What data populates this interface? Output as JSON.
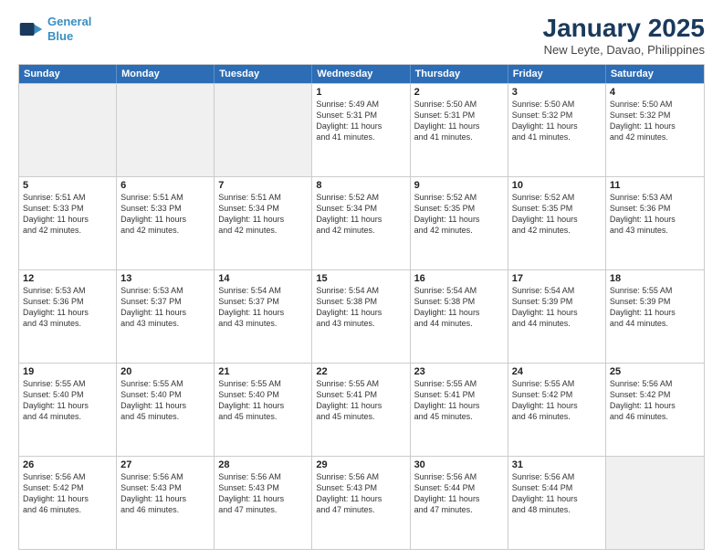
{
  "logo": {
    "line1": "General",
    "line2": "Blue"
  },
  "title": "January 2025",
  "subtitle": "New Leyte, Davao, Philippines",
  "weekdays": [
    "Sunday",
    "Monday",
    "Tuesday",
    "Wednesday",
    "Thursday",
    "Friday",
    "Saturday"
  ],
  "weeks": [
    [
      {
        "day": "",
        "info": "",
        "shaded": true
      },
      {
        "day": "",
        "info": "",
        "shaded": true
      },
      {
        "day": "",
        "info": "",
        "shaded": true
      },
      {
        "day": "1",
        "info": "Sunrise: 5:49 AM\nSunset: 5:31 PM\nDaylight: 11 hours\nand 41 minutes.",
        "shaded": false
      },
      {
        "day": "2",
        "info": "Sunrise: 5:50 AM\nSunset: 5:31 PM\nDaylight: 11 hours\nand 41 minutes.",
        "shaded": false
      },
      {
        "day": "3",
        "info": "Sunrise: 5:50 AM\nSunset: 5:32 PM\nDaylight: 11 hours\nand 41 minutes.",
        "shaded": false
      },
      {
        "day": "4",
        "info": "Sunrise: 5:50 AM\nSunset: 5:32 PM\nDaylight: 11 hours\nand 42 minutes.",
        "shaded": false
      }
    ],
    [
      {
        "day": "5",
        "info": "Sunrise: 5:51 AM\nSunset: 5:33 PM\nDaylight: 11 hours\nand 42 minutes.",
        "shaded": false
      },
      {
        "day": "6",
        "info": "Sunrise: 5:51 AM\nSunset: 5:33 PM\nDaylight: 11 hours\nand 42 minutes.",
        "shaded": false
      },
      {
        "day": "7",
        "info": "Sunrise: 5:51 AM\nSunset: 5:34 PM\nDaylight: 11 hours\nand 42 minutes.",
        "shaded": false
      },
      {
        "day": "8",
        "info": "Sunrise: 5:52 AM\nSunset: 5:34 PM\nDaylight: 11 hours\nand 42 minutes.",
        "shaded": false
      },
      {
        "day": "9",
        "info": "Sunrise: 5:52 AM\nSunset: 5:35 PM\nDaylight: 11 hours\nand 42 minutes.",
        "shaded": false
      },
      {
        "day": "10",
        "info": "Sunrise: 5:52 AM\nSunset: 5:35 PM\nDaylight: 11 hours\nand 42 minutes.",
        "shaded": false
      },
      {
        "day": "11",
        "info": "Sunrise: 5:53 AM\nSunset: 5:36 PM\nDaylight: 11 hours\nand 43 minutes.",
        "shaded": false
      }
    ],
    [
      {
        "day": "12",
        "info": "Sunrise: 5:53 AM\nSunset: 5:36 PM\nDaylight: 11 hours\nand 43 minutes.",
        "shaded": false
      },
      {
        "day": "13",
        "info": "Sunrise: 5:53 AM\nSunset: 5:37 PM\nDaylight: 11 hours\nand 43 minutes.",
        "shaded": false
      },
      {
        "day": "14",
        "info": "Sunrise: 5:54 AM\nSunset: 5:37 PM\nDaylight: 11 hours\nand 43 minutes.",
        "shaded": false
      },
      {
        "day": "15",
        "info": "Sunrise: 5:54 AM\nSunset: 5:38 PM\nDaylight: 11 hours\nand 43 minutes.",
        "shaded": false
      },
      {
        "day": "16",
        "info": "Sunrise: 5:54 AM\nSunset: 5:38 PM\nDaylight: 11 hours\nand 44 minutes.",
        "shaded": false
      },
      {
        "day": "17",
        "info": "Sunrise: 5:54 AM\nSunset: 5:39 PM\nDaylight: 11 hours\nand 44 minutes.",
        "shaded": false
      },
      {
        "day": "18",
        "info": "Sunrise: 5:55 AM\nSunset: 5:39 PM\nDaylight: 11 hours\nand 44 minutes.",
        "shaded": false
      }
    ],
    [
      {
        "day": "19",
        "info": "Sunrise: 5:55 AM\nSunset: 5:40 PM\nDaylight: 11 hours\nand 44 minutes.",
        "shaded": false
      },
      {
        "day": "20",
        "info": "Sunrise: 5:55 AM\nSunset: 5:40 PM\nDaylight: 11 hours\nand 45 minutes.",
        "shaded": false
      },
      {
        "day": "21",
        "info": "Sunrise: 5:55 AM\nSunset: 5:40 PM\nDaylight: 11 hours\nand 45 minutes.",
        "shaded": false
      },
      {
        "day": "22",
        "info": "Sunrise: 5:55 AM\nSunset: 5:41 PM\nDaylight: 11 hours\nand 45 minutes.",
        "shaded": false
      },
      {
        "day": "23",
        "info": "Sunrise: 5:55 AM\nSunset: 5:41 PM\nDaylight: 11 hours\nand 45 minutes.",
        "shaded": false
      },
      {
        "day": "24",
        "info": "Sunrise: 5:55 AM\nSunset: 5:42 PM\nDaylight: 11 hours\nand 46 minutes.",
        "shaded": false
      },
      {
        "day": "25",
        "info": "Sunrise: 5:56 AM\nSunset: 5:42 PM\nDaylight: 11 hours\nand 46 minutes.",
        "shaded": false
      }
    ],
    [
      {
        "day": "26",
        "info": "Sunrise: 5:56 AM\nSunset: 5:42 PM\nDaylight: 11 hours\nand 46 minutes.",
        "shaded": false
      },
      {
        "day": "27",
        "info": "Sunrise: 5:56 AM\nSunset: 5:43 PM\nDaylight: 11 hours\nand 46 minutes.",
        "shaded": false
      },
      {
        "day": "28",
        "info": "Sunrise: 5:56 AM\nSunset: 5:43 PM\nDaylight: 11 hours\nand 47 minutes.",
        "shaded": false
      },
      {
        "day": "29",
        "info": "Sunrise: 5:56 AM\nSunset: 5:43 PM\nDaylight: 11 hours\nand 47 minutes.",
        "shaded": false
      },
      {
        "day": "30",
        "info": "Sunrise: 5:56 AM\nSunset: 5:44 PM\nDaylight: 11 hours\nand 47 minutes.",
        "shaded": false
      },
      {
        "day": "31",
        "info": "Sunrise: 5:56 AM\nSunset: 5:44 PM\nDaylight: 11 hours\nand 48 minutes.",
        "shaded": false
      },
      {
        "day": "",
        "info": "",
        "shaded": true
      }
    ]
  ]
}
